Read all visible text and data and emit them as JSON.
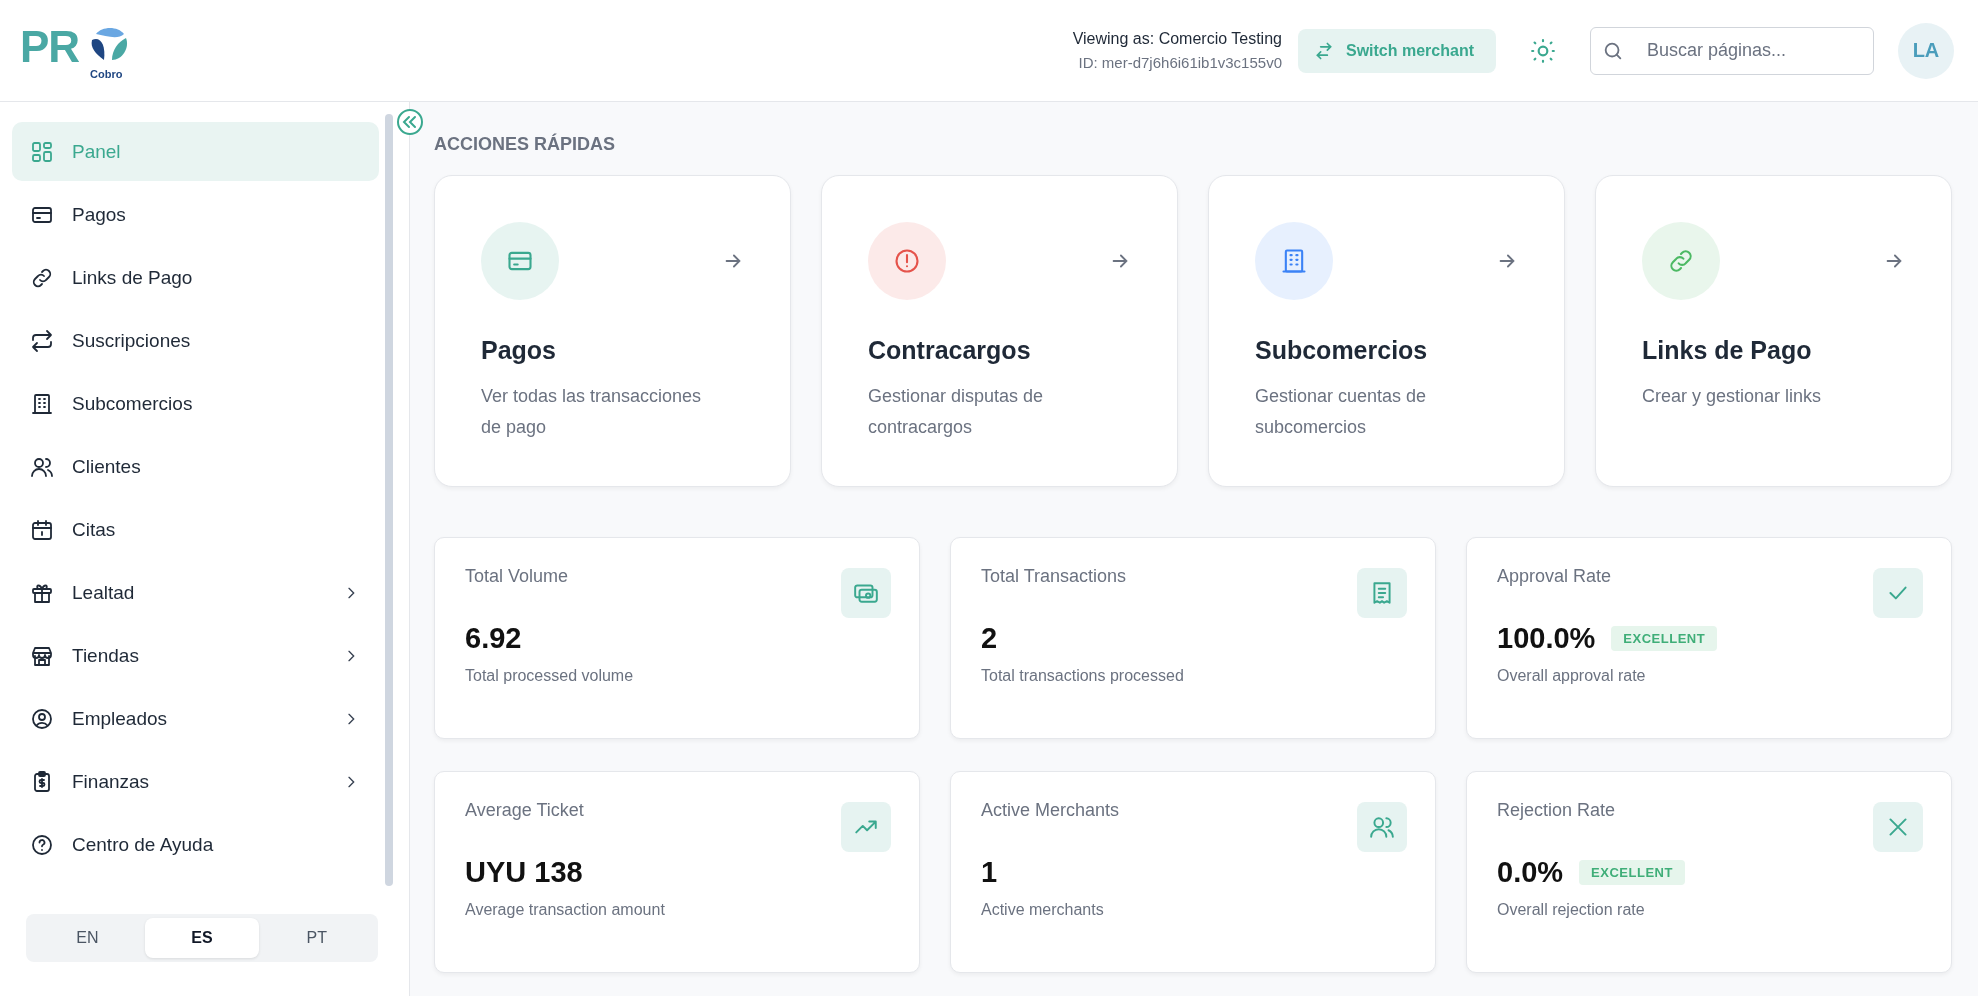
{
  "header": {
    "logo_text": "PR",
    "logo_sub": "Cobro",
    "viewing_as": "Viewing as: Comercio Testing",
    "merchant_id": "ID: mer-d7j6h6i61ib1v3c155v0",
    "switch_button": "Switch merchant",
    "search": {
      "placeholder": "Buscar páginas..."
    },
    "avatar": "LA"
  },
  "sidebar": {
    "items": [
      {
        "label": "Panel",
        "kind": "grid",
        "selected": true,
        "expandable": false
      },
      {
        "label": "Pagos",
        "kind": "card",
        "selected": false,
        "expandable": false
      },
      {
        "label": "Links de Pago",
        "kind": "link",
        "selected": false,
        "expandable": false
      },
      {
        "label": "Suscripciones",
        "kind": "repeat",
        "selected": false,
        "expandable": false
      },
      {
        "label": "Subcomercios",
        "kind": "building",
        "selected": false,
        "expandable": false
      },
      {
        "label": "Clientes",
        "kind": "users",
        "selected": false,
        "expandable": false
      },
      {
        "label": "Citas",
        "kind": "calendar",
        "selected": false,
        "expandable": false
      },
      {
        "label": "Lealtad",
        "kind": "gift",
        "selected": false,
        "expandable": true
      },
      {
        "label": "Tiendas",
        "kind": "store",
        "selected": false,
        "expandable": true
      },
      {
        "label": "Empleados",
        "kind": "person",
        "selected": false,
        "expandable": true
      },
      {
        "label": "Finanzas",
        "kind": "finance",
        "selected": false,
        "expandable": true
      },
      {
        "label": "Centro de Ayuda",
        "kind": "help",
        "selected": false,
        "expandable": false
      }
    ],
    "languages": [
      {
        "label": "EN",
        "selected": false
      },
      {
        "label": "ES",
        "selected": true
      },
      {
        "label": "PT",
        "selected": false
      }
    ]
  },
  "quick_actions": {
    "title": "ACCIONES RÁPIDAS",
    "cards": [
      {
        "title": "Pagos",
        "description": "Ver todas las transacciones de pago",
        "kind": "card",
        "color": "#3aa88f"
      },
      {
        "title": "Contracargos",
        "description": "Gestionar disputas de contracargos",
        "kind": "alert",
        "color": "#e5534b"
      },
      {
        "title": "Subcomercios",
        "description": "Gestionar cuentas de subcomercios",
        "kind": "building",
        "color": "#3b82f6"
      },
      {
        "title": "Links de Pago",
        "description": "Crear y gestionar links",
        "kind": "link",
        "color": "#4cb963"
      }
    ]
  },
  "stats": [
    {
      "label": "Total Volume",
      "value": "6.92",
      "caption": "Total processed volume",
      "kind": "money"
    },
    {
      "label": "Total Transactions",
      "value": "2",
      "caption": "Total transactions processed",
      "kind": "receipt"
    },
    {
      "label": "Approval Rate",
      "value": "100.0%",
      "badge": "EXCELLENT",
      "caption": "Overall approval rate",
      "kind": "check"
    },
    {
      "label": "Average Ticket",
      "value": "UYU 138",
      "caption": "Average transaction amount",
      "kind": "trend"
    },
    {
      "label": "Active Merchants",
      "value": "1",
      "caption": "Active merchants",
      "kind": "users"
    },
    {
      "label": "Rejection Rate",
      "value": "0.0%",
      "badge": "EXCELLENT",
      "caption": "Overall rejection rate",
      "kind": "x"
    }
  ]
}
